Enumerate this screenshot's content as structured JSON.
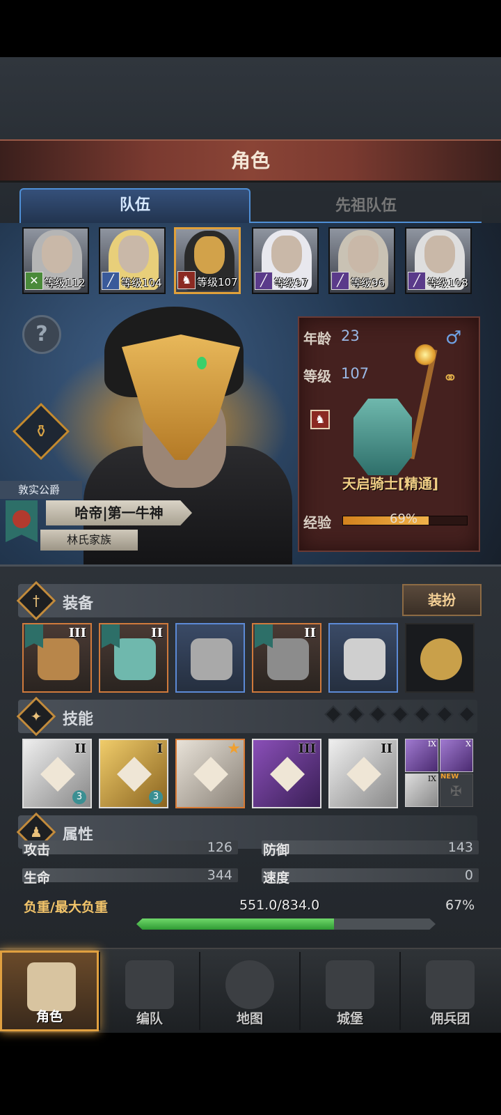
{
  "header": {
    "title": "角色"
  },
  "tabs": [
    {
      "label": "队伍"
    },
    {
      "label": "先祖队伍"
    }
  ],
  "team": [
    {
      "level_label": "等级112",
      "class_icon": "sword-icon",
      "hair_color": "#b5b5b5"
    },
    {
      "level_label": "等级104",
      "class_icon": "spear-icon",
      "hair_color": "#e8cf7a"
    },
    {
      "level_label": "等级107",
      "class_icon": "horse-icon",
      "hair_color": "#2a2a2a"
    },
    {
      "level_label": "等级97",
      "class_icon": "staff-icon",
      "hair_color": "#e8e8ee"
    },
    {
      "level_label": "等级96",
      "class_icon": "staff-icon",
      "hair_color": "#c9c2b4"
    },
    {
      "level_label": "等级108",
      "class_icon": "staff-icon",
      "hair_color": "#dedede"
    }
  ],
  "hero": {
    "rank_title": "敦实公爵",
    "name": "哈帝|第一牛神",
    "family": "林氏家族",
    "age_label": "年龄",
    "age": "23",
    "level_label": "等级",
    "level": "107",
    "class_name": "天启骑士[精通]",
    "exp_label": "经验",
    "exp_percent": "69%",
    "exp_fraction": 0.69
  },
  "equipment": {
    "title": "装备",
    "dress_button": "装扮",
    "slots": [
      {
        "item": "gauntlet",
        "tier": "III",
        "style": "orange",
        "flag": true
      },
      {
        "item": "shield",
        "tier": "II",
        "style": "orange",
        "flag": true
      },
      {
        "item": "helmet",
        "tier": "",
        "style": "blue",
        "flag": false
      },
      {
        "item": "armor",
        "tier": "II",
        "style": "orange",
        "flag": true
      },
      {
        "item": "boots",
        "tier": "",
        "style": "blue",
        "flag": false
      },
      {
        "item": "amulet",
        "tier": "",
        "style": "dark",
        "flag": false
      }
    ]
  },
  "skills": {
    "title": "技能",
    "gems_count": 7,
    "list": [
      {
        "tier": "II",
        "count": "3",
        "style": "white"
      },
      {
        "tier": "I",
        "count": "3",
        "style": "gold"
      },
      {
        "tier": "",
        "count": "",
        "style": "orange"
      },
      {
        "tier": "III",
        "count": "",
        "style": "purple"
      },
      {
        "tier": "II",
        "count": "",
        "style": "white"
      }
    ],
    "mini": [
      {
        "tier": "IX",
        "badge": ""
      },
      {
        "tier": "X",
        "badge": ""
      },
      {
        "tier": "IX",
        "badge": ""
      },
      {
        "tier": "",
        "badge": "NEW"
      }
    ]
  },
  "attributes": {
    "title": "属性",
    "attack_label": "攻击",
    "attack": "126",
    "defense_label": "防御",
    "defense": "143",
    "life_label": "生命",
    "life": "344",
    "speed_label": "速度",
    "speed": "0",
    "load_label": "负重/最大负重",
    "load": "551.0/834.0",
    "load_percent": "67%",
    "load_fraction": 0.66
  },
  "nav": [
    {
      "label": "角色",
      "active": true
    },
    {
      "label": "编队",
      "active": false
    },
    {
      "label": "地图",
      "active": false
    },
    {
      "label": "城堡",
      "active": false
    },
    {
      "label": "佣兵团",
      "active": false
    }
  ],
  "colors": {
    "accent": "#e0a040",
    "tab_blue": "#4f8fd6",
    "exp": "#f0b24a",
    "load": "#2f9a33"
  }
}
